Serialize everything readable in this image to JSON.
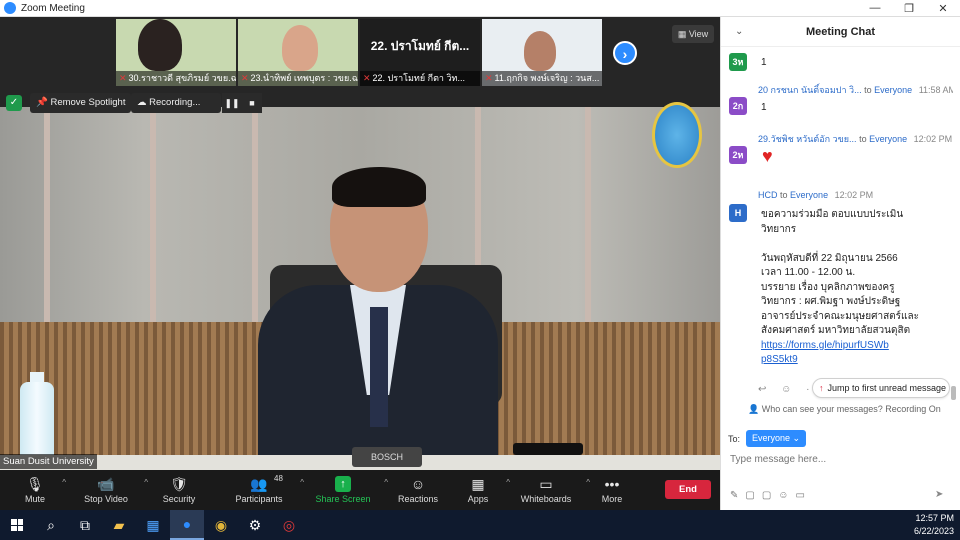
{
  "window": {
    "title": "Zoom Meeting",
    "buttons": [
      "—",
      "❐",
      "✕"
    ]
  },
  "thumbnails": [
    {
      "name": "30.ราชาวดี สุขภิรมย์ วขย.ฉ",
      "big": ""
    },
    {
      "name": "23.นำทิพย์ เทพบุตร : วขย.ฉ",
      "big": ""
    },
    {
      "name": "22. ปราโมทย์ กีตา วิท...",
      "big": "22. ปราโมทย์ กีต..."
    },
    {
      "name": "11.ฤกกิจ พงษ์เจริญ : วนส...",
      "big": ""
    }
  ],
  "view_button": "View",
  "spotlight": "Remove Spotlight",
  "recording": "Recording...",
  "venue_label": "Suan Dusit University",
  "mic_brand": "BOSCH",
  "toolbar": {
    "mute": "Mute",
    "stop_video": "Stop Video",
    "security": "Security",
    "participants": "Participants",
    "participant_count": "48",
    "share_screen": "Share Screen",
    "reactions": "Reactions",
    "apps": "Apps",
    "whiteboards": "Whiteboards",
    "more": "More",
    "end": "End"
  },
  "chat": {
    "title": "Meeting Chat",
    "messages": [
      {
        "avatar": "3ห",
        "avatar_color": "#1f9a4c",
        "text": "1"
      },
      {
        "avatar": "2ก",
        "avatar_color": "#8b4cc7",
        "sender": "20 กรชนก นันติ์จอมปา วิ...",
        "to": "to",
        "recipient": "Everyone",
        "time": "11:58 AM",
        "text": "1"
      },
      {
        "avatar": "2ห",
        "avatar_color": "#8b4cc7",
        "sender": "29.วัชพิช หวันต์อัก วขย...",
        "to": "to",
        "recipient": "Everyone",
        "time": "12:02 PM"
      },
      {
        "avatar": "H",
        "avatar_color": "#2d6cc9",
        "sender": "HCD",
        "to": "to",
        "recipient": "Everyone",
        "time": "12:02 PM",
        "lines": [
          "ขอความร่วมมือ ตอบแบบประเมิน",
          "วิทยากร",
          "",
          "วันพฤหัสบดีที่ 22 มิถุนายน 2566",
          "เวลา 11.00 - 12.00 น.",
          "บรรยาย เรื่อง บุคลิกภาพของครู",
          "วิทยากร : ผศ.พิมฐา พงษ์ประดิษฐ",
          "อาจารย์ประจำคณะมนุษยศาสตร์และ",
          "สังคมศาสตร์ มหาวิทยาลัยสวนดุสิต"
        ],
        "link": [
          "https://forms.gle/hipurfUSWb",
          "p8S5kt9"
        ]
      }
    ],
    "jump_label": "Jump to first unread message",
    "who_can_see": "Who can see your messages? Recording On",
    "to_label": "To:",
    "recipient": "Everyone",
    "input_placeholder": "Type message here..."
  },
  "clock": {
    "time": "12:57 PM",
    "date": "6/22/2023"
  },
  "colors": {
    "accent": "#2d8cff",
    "end": "#d7263d",
    "share": "#19b04c"
  }
}
